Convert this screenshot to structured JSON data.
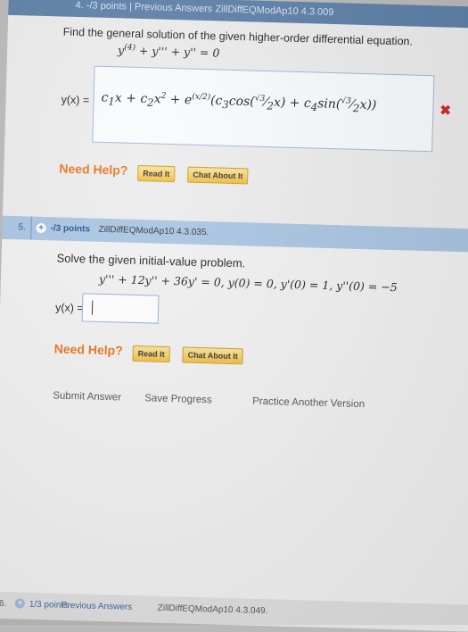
{
  "q4": {
    "header_text": "4. -/3 points | Previous Answers ZillDiffEQModAp10 4.3.009",
    "question": "Find the general solution of the given higher-order differential equation.",
    "equation": "y(4) + y''' + y'' = 0",
    "answer_label": "y(x) =",
    "answer_value": "c1x + c2x² + e(x/2)(c3cos(√3/2 x) + c4sin(√3/2 x))",
    "status_icon": "x-icon",
    "need_help": "Need Help?",
    "read_it": "Read It",
    "chat_about_it": "Chat About It"
  },
  "q5": {
    "number": "5.",
    "points": "-/3 points",
    "reference": "ZillDiffEQModAp10 4.3.035.",
    "question": "Solve the given initial-value problem.",
    "ivp": "y''' + 12y'' + 36y' = 0,  y(0) = 0, y'(0) = 1, y''(0) = −5",
    "answer_label": "y(x) =",
    "answer_value": "",
    "need_help": "Need Help?",
    "read_it": "Read It",
    "chat_about_it": "Chat About It",
    "submit": "Submit Answer",
    "save": "Save Progress",
    "practice": "Practice Another Version"
  },
  "q6": {
    "number": "6.",
    "points": "1/3 points",
    "previous_answers": "Previous Answers",
    "reference": "ZillDiffEQModAp10 4.3.049."
  },
  "colors": {
    "header_blue": "#5a7ea6",
    "row_blue": "#a8c4e3",
    "help_orange": "#e8731a",
    "wrong_red": "#d12222",
    "button_gold": "#f0bd3e"
  }
}
